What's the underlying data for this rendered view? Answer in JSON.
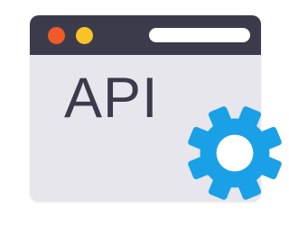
{
  "window": {
    "title_bar_color": "#3b3b4c",
    "body_color": "#e6e6ec",
    "buttons": [
      {
        "icon": "close-dot-icon",
        "color": "#f05a28"
      },
      {
        "icon": "minimize-dot-icon",
        "color": "#f7c325"
      }
    ],
    "address_bar_color": "#ffffff"
  },
  "label": "API",
  "gear": {
    "icon": "gear-icon",
    "color": "#1aa0e6"
  }
}
